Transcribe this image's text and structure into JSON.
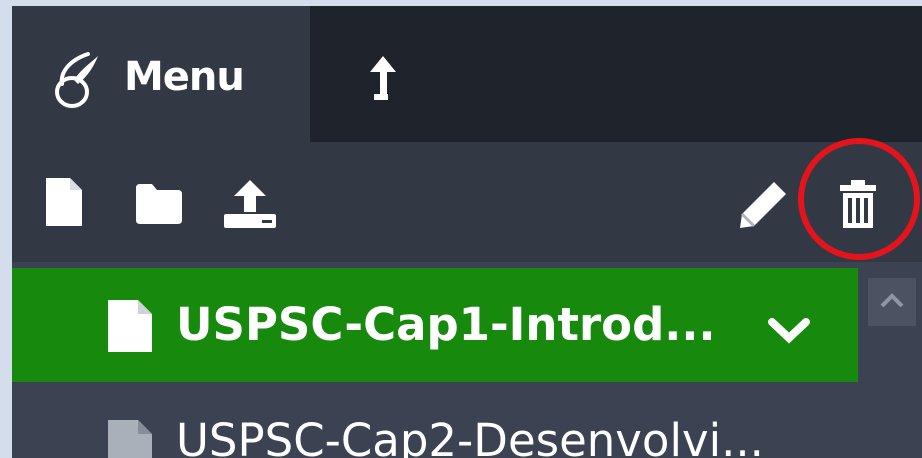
{
  "header": {
    "menu_label": "Menu"
  },
  "toolbar": {
    "new_file_icon": "file-icon",
    "new_folder_icon": "folder-icon",
    "upload_icon": "upload-icon",
    "rename_icon": "pencil-icon",
    "delete_icon": "trash-icon"
  },
  "file_list": {
    "items": [
      {
        "label": "USPSC-Cap1-Introd...",
        "selected": true
      },
      {
        "label": "USPSC-Cap2-Desenvolvi...",
        "selected": false
      }
    ]
  },
  "colors": {
    "selected_row": "#178a0e",
    "annotation_circle": "#e5141c"
  }
}
